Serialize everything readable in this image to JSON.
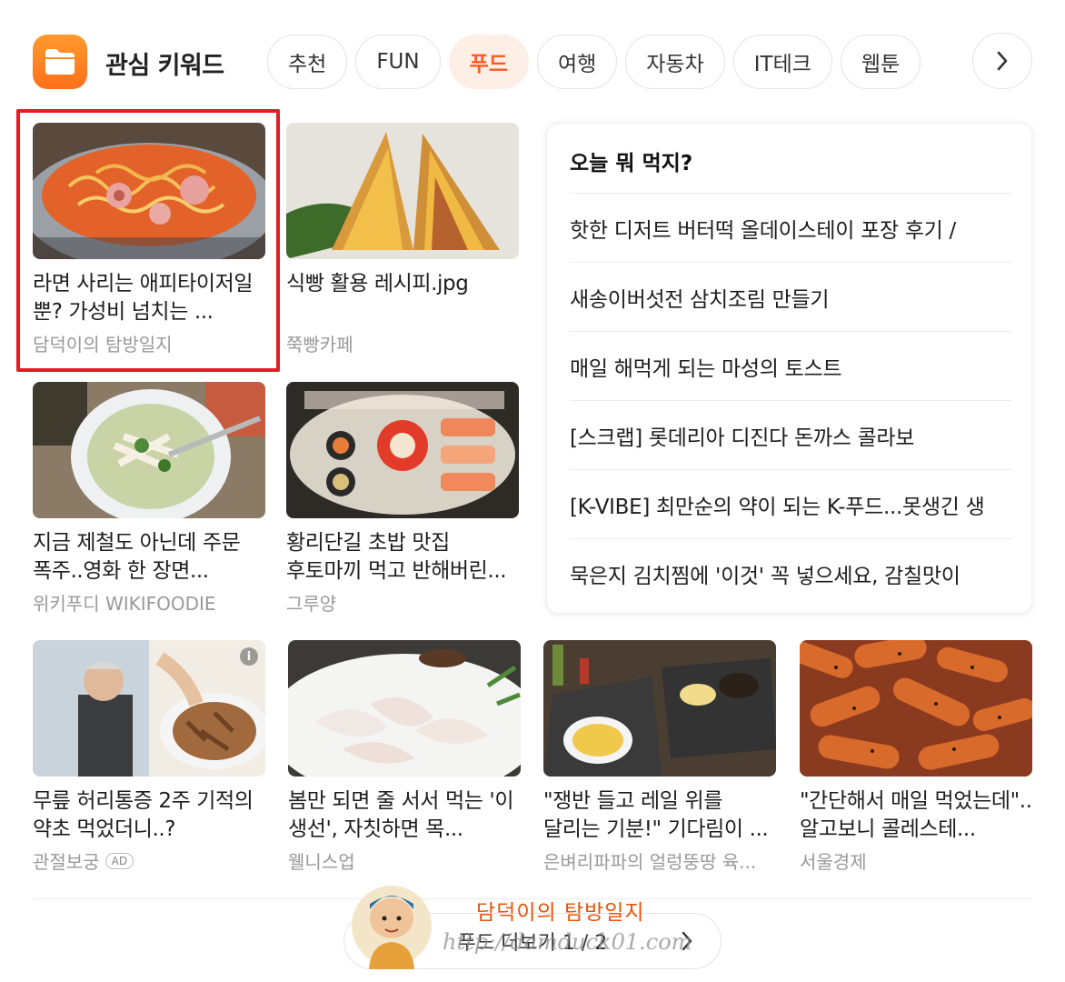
{
  "header": {
    "title": "관심 키워드",
    "app_icon": "folder-icon",
    "tabs": [
      {
        "label": "추천"
      },
      {
        "label": "FUN"
      },
      {
        "label": "푸드"
      },
      {
        "label": "여행"
      },
      {
        "label": "자동차"
      },
      {
        "label": "IT테크"
      },
      {
        "label": "웹툰"
      }
    ],
    "active_tab": "푸드",
    "next_icon": "chevron-right-icon"
  },
  "cards": [
    {
      "title": "라면 사리는 애피타이저일 뿐? 가성비 넘치는 ...",
      "source": "담덕이의 탐방일지",
      "image": "ramen-stew-photo"
    },
    {
      "title": "식빵 활용 레시피.jpg",
      "source": "쭉빵카페",
      "image": "toast-sandwich-photo"
    },
    {
      "title": "지금 제철도 아닌데 주문 폭주..영화 한 장면...",
      "source": "위키푸디 WIKIFOODIE",
      "image": "noodle-soup-photo"
    },
    {
      "title": "황리단길 초밥 맛집 후토마끼 먹고 반해버린...",
      "source": "그루양",
      "image": "sushi-platter-photo"
    },
    {
      "title": "무릎 허리통증 2주 기적의 약초 먹었더니..?",
      "source": "관절보궁",
      "ad": "AD",
      "image": "herbal-ad-photo"
    },
    {
      "title": "봄만 되면 줄 서서 먹는 '이 생선', 자칫하면 목...",
      "source": "웰니스업",
      "image": "raw-fish-photo"
    },
    {
      "title": "\"쟁반 들고 레일 위를 달리는 기분!\" 기다림이 ...",
      "source": "은벼리파파의 얼렁뚱땅 육...",
      "image": "tray-meal-photo"
    },
    {
      "title": "\"간단해서 매일 먹었는데\"..알고보니 콜레스테...",
      "source": "서울경제",
      "image": "sausages-photo"
    }
  ],
  "side": {
    "title": "오늘 뭐 먹지?",
    "items": [
      {
        "label": "핫한 디저트 버터떡 올데이스테이 포장 후기 /"
      },
      {
        "label": "새송이버섯전 삼치조림 만들기"
      },
      {
        "label": "매일 해먹게 되는 마성의 토스트"
      },
      {
        "label": "[스크랩] 롯데리아 디진다 돈까스 콜라보"
      },
      {
        "label": "[K-VIBE] 최만순의 약이 되는 K-푸드...못생긴 생"
      },
      {
        "label": "묵은지 김치찜에 '이것' 꼭 넣으세요, 감칠맛이"
      }
    ]
  },
  "more": {
    "label": "푸드 더보기 1 / 2"
  },
  "watermark": {
    "name": "담덕이의 탐방일지",
    "url": "http://damduck01.com"
  },
  "colors": {
    "accent": "#ff5a1f",
    "highlight": "#e51c23",
    "icon_orange": "#ff7a1f"
  }
}
